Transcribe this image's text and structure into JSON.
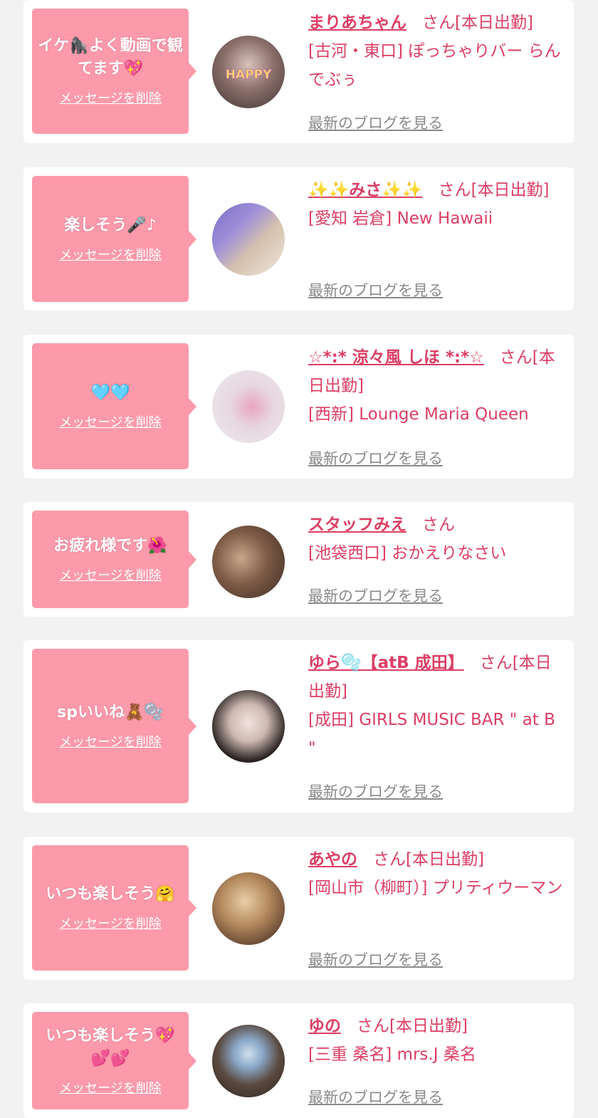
{
  "cards": [
    {
      "message": "イケ🦍よく動画で観てます💖",
      "delete_label": "メッセージを削除",
      "name": "まりあちゃん",
      "suffix": "さん[本日出勤]",
      "shop": "[古河・東口] ぽっちゃりバー らんでぶぅ",
      "blog_label": "最新のブログを見る",
      "avatar_icon": "avatar-photo-happy"
    },
    {
      "message": "楽しそう🎤♪",
      "delete_label": "メッセージを削除",
      "name": "✨✨みさ✨✨",
      "suffix": "さん[本日出勤]",
      "shop": "[愛知 岩倉] New Hawaii",
      "blog_label": "最新のブログを見る",
      "avatar_icon": "avatar-photo-purple-hair"
    },
    {
      "message": "🩵🩵",
      "delete_label": "メッセージを削除",
      "name": "☆*:* 涼々風 しほ *:*☆",
      "suffix": "さん[本日出勤]",
      "shop": "[西新] Lounge Maria Queen",
      "blog_label": "最新のブログを見る",
      "avatar_icon": "avatar-photo-kimono"
    },
    {
      "message": "お疲れ様です🌺",
      "delete_label": "メッセージを削除",
      "name": "スタッフみえ",
      "suffix": "さん",
      "shop": "[池袋西口] おかえりなさい",
      "blog_label": "最新のブログを見る",
      "avatar_icon": "avatar-photo-mask"
    },
    {
      "message": "spいいね🧸🫧",
      "delete_label": "メッセージを削除",
      "name": "ゆら🫧【atB 成田】",
      "suffix": "さん[本日出勤]",
      "shop": "[成田] GIRLS MUSIC BAR \" at B \"",
      "blog_label": "最新のブログを見る",
      "avatar_icon": "avatar-photo-black-hair"
    },
    {
      "message": "いつも楽しそう🤗",
      "delete_label": "メッセージを削除",
      "name": "あやの",
      "suffix": "さん[本日出勤]",
      "shop": "[岡山市（柳町）] プリティウーマン",
      "blog_label": "最新のブログを見る",
      "avatar_icon": "avatar-photo-hair-clip"
    },
    {
      "message": "いつも楽しそう💖💕💕",
      "delete_label": "メッセージを削除",
      "name": "ゆの",
      "suffix": "さん[本日出勤]",
      "shop": "[三重 桑名] mrs.J 桑名",
      "blog_label": "最新のブログを見る",
      "avatar_icon": "avatar-photo-card"
    }
  ],
  "colors": {
    "accent": "#dc3e63",
    "bubble": "#fc9aab",
    "muted": "#8a8a8a",
    "background": "#f2f2f2"
  }
}
